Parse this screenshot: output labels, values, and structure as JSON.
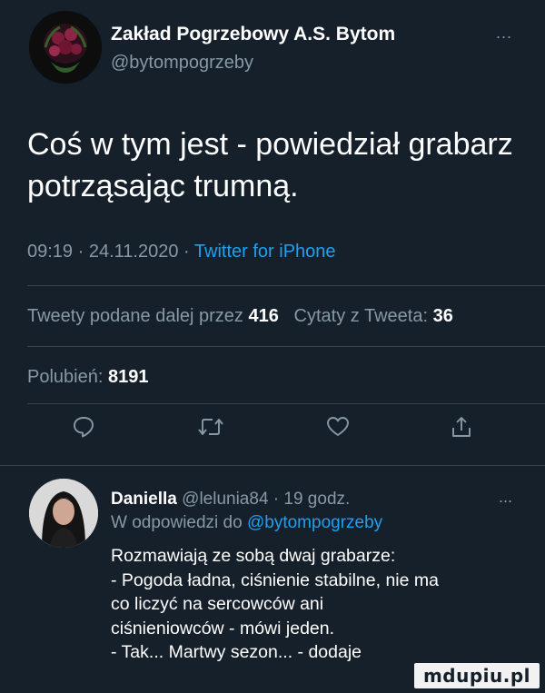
{
  "tweet": {
    "author_name": "Zakład Pogrzebowy A.S. Bytom",
    "author_handle": "@bytompogrzeby",
    "more": "...",
    "text": "Coś w tym jest - powiedział grabarz potrząsając trumną.",
    "time": "09:19",
    "sep1": "·",
    "date": "24.11.2020",
    "sep2": "·",
    "source": "Twitter for iPhone",
    "retweets_label": "Tweety podane dalej przez",
    "retweets_count": "416",
    "quotes_label": "Cytaty z Tweeta:",
    "quotes_count": "36",
    "likes_label": "Polubień:",
    "likes_count": "8191"
  },
  "actions": {
    "icons": [
      "reply-icon",
      "retweet-icon",
      "like-icon",
      "share-icon"
    ]
  },
  "reply": {
    "name": "Daniella",
    "handle_time": "@lelunia84 · 19 godz.",
    "more": "...",
    "reply_to_label": "W odpowiedzi do",
    "reply_to_mention": "@bytompogrzeby",
    "lines": [
      "Rozmawiają ze sobą dwaj grabarze:",
      "- Pogoda ładna, ciśnienie stabilne, nie ma",
      "co liczyć na sercowców ani",
      "ciśnieniowców - mówi jeden.",
      "- Tak... Martwy sezon... - dodaje"
    ]
  },
  "watermark": {
    "text": "mdupiu.pl"
  },
  "colors": {
    "background": "#15202b",
    "muted": "#8899a6",
    "accent": "#1da1f2",
    "divider": "#38444d"
  }
}
